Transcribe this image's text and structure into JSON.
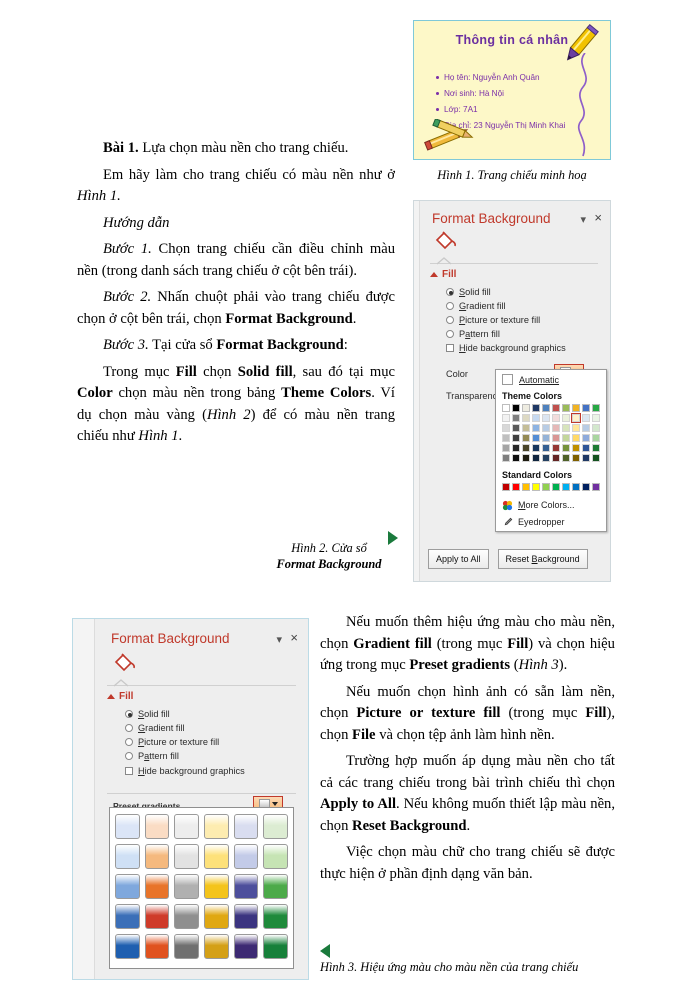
{
  "figure1": {
    "slide": {
      "title": "Thông tin cá nhân",
      "bullets": [
        "Họ tên: Nguyễn Anh Quân",
        "Nơi sinh: Hà Nội",
        "Lớp: 7A1",
        "Địa chỉ: 23 Nguyễn Thị Minh Khai"
      ],
      "background_color": "#fdf8c8",
      "title_color": "#6b2fa0",
      "text_color": "#7b2fa8",
      "border_color": "#7fc9d8",
      "decorations": [
        "pencil-icon",
        "pencil-icon",
        "squiggle-line"
      ]
    },
    "caption": "Hình 1. Trang chiếu minh hoạ"
  },
  "left_text": {
    "p1_pre": "Bài 1.",
    "p1_rest": " Lựa chọn màu nền cho trang chiếu.",
    "p2": "Em hãy làm cho trang chiếu có màu nền như ở ",
    "p2_i": "Hình 1.",
    "p3": "Hướng dẫn",
    "p4_i": "Bước 1.",
    "p4": " Chọn trang chiếu cần điều chỉnh màu nền (trong danh sách trang chiếu ở cột bên trái).",
    "p5_i": "Bước 2.",
    "p5a": " Nhấn chuột phải vào trang chiếu được chọn ở cột bên trái, chọn ",
    "p5b": "Format Background",
    "p5c": ".",
    "p6_i": "Bước 3.",
    "p6a": " Tại cửa sổ ",
    "p6b": "Format Background",
    "p6c": ":",
    "p7a": "Trong mục ",
    "p7b": "Fill",
    "p7c": " chọn ",
    "p7d": "Solid fill",
    "p7e": ", sau đó tại mục ",
    "p7f": "Color",
    "p7g": " chọn màu nền trong bảng ",
    "p7h": "Theme Colors",
    "p7i": ". Ví dụ chọn màu vàng (",
    "p7j": "Hình 2",
    "p7k": ") để có màu nền trang chiếu như ",
    "p7l": "Hình 1",
    "p7m": "."
  },
  "figure2": {
    "panel": {
      "title": "Format Background",
      "icon": "paint-bucket-icon",
      "collapse_label": "chevron-down-icon",
      "close_label": "×",
      "section_label": "Fill",
      "options": [
        {
          "label": "Solid fill",
          "mnemonic": "S",
          "selected": true
        },
        {
          "label": "Gradient fill",
          "mnemonic": "G",
          "selected": false
        },
        {
          "label": "Picture or texture fill",
          "mnemonic": "P",
          "selected": false
        },
        {
          "label": "Pattern fill",
          "mnemonic": "a",
          "selected": false
        }
      ],
      "checkbox_label": "Hide background graphics",
      "color_label": "Color",
      "transparency_label": "Transparency",
      "buttons": [
        "Apply to All",
        "Reset Background"
      ]
    },
    "color_menu": {
      "automatic_label": "Automatic",
      "theme_colors_label": "Theme Colors",
      "standard_colors_label": "Standard Colors",
      "more_colors_label": "More Colors...",
      "eyedropper_label": "Eyedropper",
      "theme_base": [
        "#ffffff",
        "#000000",
        "#eeece1",
        "#1f3864",
        "#4f81bd",
        "#c0504d",
        "#9bbb59",
        "#f0b323",
        "#4472c4",
        "#27a844"
      ],
      "theme_variants": [
        [
          "#f2f2f2",
          "#7f7f7f",
          "#ddd9c3",
          "#c6d9f0",
          "#dbe5f1",
          "#f2dcdb",
          "#ebf1dd",
          "#fff2cc",
          "#dce6f1",
          "#ebf4e6"
        ],
        [
          "#d8d8d8",
          "#595959",
          "#c4bd97",
          "#8db3e2",
          "#b8cce4",
          "#e5b8b7",
          "#d7e4bc",
          "#ffe699",
          "#b8cce4",
          "#d3e8cd"
        ],
        [
          "#bfbfbf",
          "#3f3f3f",
          "#948a54",
          "#548dd4",
          "#95b3d7",
          "#d99694",
          "#c3d69b",
          "#ffd966",
          "#8eaadb",
          "#a9d5a0"
        ],
        [
          "#a5a5a5",
          "#262626",
          "#494429",
          "#17365d",
          "#366092",
          "#953734",
          "#76923c",
          "#bf9000",
          "#2f5597",
          "#1e7b34"
        ],
        [
          "#7f7f7f",
          "#0c0c0c",
          "#1d1b10",
          "#0f243e",
          "#244061",
          "#632423",
          "#4f6128",
          "#7f6000",
          "#1f3864",
          "#14521f"
        ]
      ],
      "standard_colors": [
        "#c00000",
        "#ff0000",
        "#ffc000",
        "#ffff00",
        "#92d050",
        "#00b050",
        "#00b0f0",
        "#0070c0",
        "#002060",
        "#7030a0"
      ],
      "selected_swatch_index": 7
    },
    "caption_line1": "Hình 2. Cửa sổ",
    "caption_line2": "Format Background",
    "arrow": "arrow-right-icon"
  },
  "figure3": {
    "panel": {
      "title": "Format Background",
      "icon": "paint-bucket-icon",
      "close_label": "×",
      "section_label": "Fill",
      "options": [
        {
          "label": "Solid fill",
          "mnemonic": "S",
          "selected": true
        },
        {
          "label": "Gradient fill",
          "mnemonic": "G",
          "selected": false
        },
        {
          "label": "Picture or texture fill",
          "mnemonic": "P",
          "selected": false
        },
        {
          "label": "Pattern fill",
          "mnemonic": "a",
          "selected": false
        }
      ],
      "checkbox_label": "Hide background graphics",
      "preset_label": "Preset gradients"
    },
    "gradient_grid": {
      "rows": 5,
      "cols": 6,
      "colors": [
        [
          "#dbe5f7",
          "#fadcc4",
          "#ededed",
          "#fdecb0",
          "#d9ddf0",
          "#dcecd2"
        ],
        [
          "#cfe0f5",
          "#f5b97e",
          "#e2e2e2",
          "#fde17a",
          "#c3cbe8",
          "#c6e4b4"
        ],
        [
          "#7fa8dd",
          "#e8742a",
          "#b0b0b0",
          "#f4c41b",
          "#4d4f9c",
          "#4caa49"
        ],
        [
          "#3b6fb8",
          "#cf3b2a",
          "#8f8f8f",
          "#e0a812",
          "#3b3480",
          "#1f8a3b"
        ],
        [
          "#1f5fb0",
          "#e0521f",
          "#707070",
          "#d4a017",
          "#3d2a73",
          "#17803a"
        ]
      ]
    },
    "caption": "Hình 3. Hiệu ứng màu cho màu nền của trang chiếu",
    "arrow": "arrow-left-icon"
  },
  "right_text": {
    "p1a": "Nếu muốn thêm hiệu ứng màu cho màu nền, chọn ",
    "p1b": "Gradient fill",
    "p1c": " (trong mục ",
    "p1d": "Fill",
    "p1e": ") và chọn hiệu ứng trong mục ",
    "p1f": "Preset gradients",
    "p1g": " (",
    "p1h": "Hình 3",
    "p1i": ").",
    "p2a": "Nếu muốn chọn hình ảnh có sẵn làm nền, chọn ",
    "p2b": "Picture or texture fill",
    "p2c": " (trong mục ",
    "p2d": "Fill",
    "p2e": "), chọn ",
    "p2f": "File",
    "p2g": " và chọn tệp ảnh làm hình nền.",
    "p3a": "Trường hợp muốn áp dụng màu nền cho tất cả các trang chiếu trong bài trình chiếu thì chọn ",
    "p3b": "Apply to All",
    "p3c": ". Nếu không muốn thiết lập màu nền, chọn ",
    "p3d": "Reset Background",
    "p3e": ".",
    "p4": "Việc chọn màu chữ cho trang chiếu sẽ được thực hiện ở phần định dạng văn bản."
  }
}
